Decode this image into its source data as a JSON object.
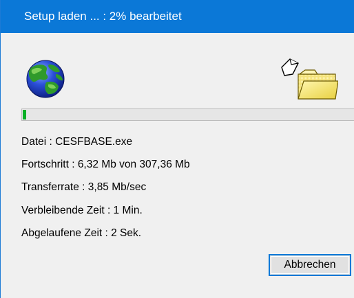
{
  "window": {
    "title": "Setup laden ... : 2% bearbeitet"
  },
  "progress": {
    "percent": 2
  },
  "info": {
    "file": "Datei : CESFBASE.exe",
    "progress": "Fortschritt : 6,32 Mb von 307,36 Mb",
    "transfer_rate": "Transferrate : 3,85 Mb/sec",
    "remaining_time": "Verbleibende Zeit : 1 Min.",
    "elapsed_time": "Abgelaufene Zeit : 2 Sek."
  },
  "buttons": {
    "cancel_label": "Abbrechen"
  },
  "icons": {
    "left": "globe-icon",
    "right": "file-transfer-folder-icon"
  },
  "colors": {
    "titlebar": "#0b78d7",
    "progress_fill": "#06b025",
    "button_border": "#0078d7"
  }
}
